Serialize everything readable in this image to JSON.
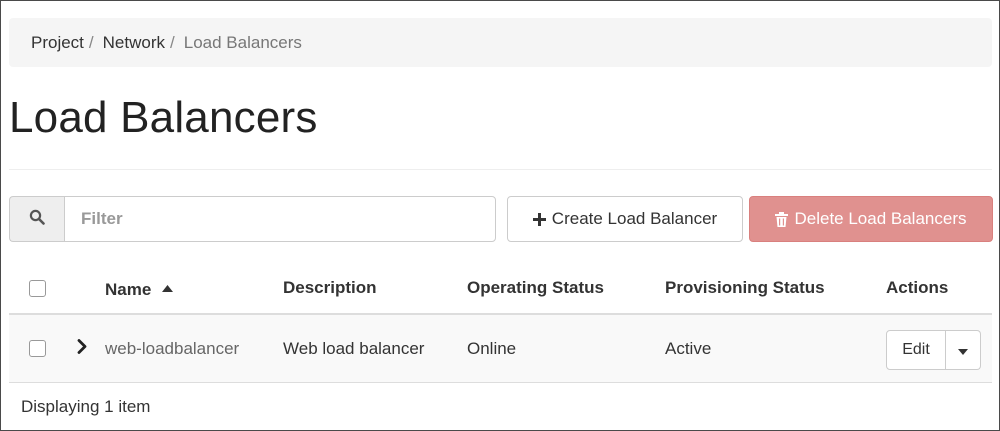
{
  "breadcrumb": {
    "items": [
      "Project",
      "Network",
      "Load Balancers"
    ],
    "separator": "/"
  },
  "page": {
    "title": "Load Balancers"
  },
  "toolbar": {
    "filter_placeholder": "Filter",
    "filter_value": "",
    "create_label": "Create Load Balancer",
    "delete_label": "Delete Load Balancers",
    "search_icon": "search-icon",
    "create_icon": "plus-icon",
    "delete_icon": "trash-icon"
  },
  "table": {
    "columns": [
      "Name",
      "Description",
      "Operating Status",
      "Provisioning Status",
      "Actions"
    ],
    "sort_column": "Name",
    "sort_direction": "ascending",
    "rows": [
      {
        "name": "web-loadbalancer",
        "description": "Web load balancer",
        "operating_status": "Online",
        "provisioning_status": "Active",
        "action_label": "Edit"
      }
    ],
    "footer": "Displaying 1 item"
  },
  "colors": {
    "delete_button": "#e0918f",
    "breadcrumb_bg": "#f5f5f5",
    "row_bg": "#f9f9f9"
  }
}
